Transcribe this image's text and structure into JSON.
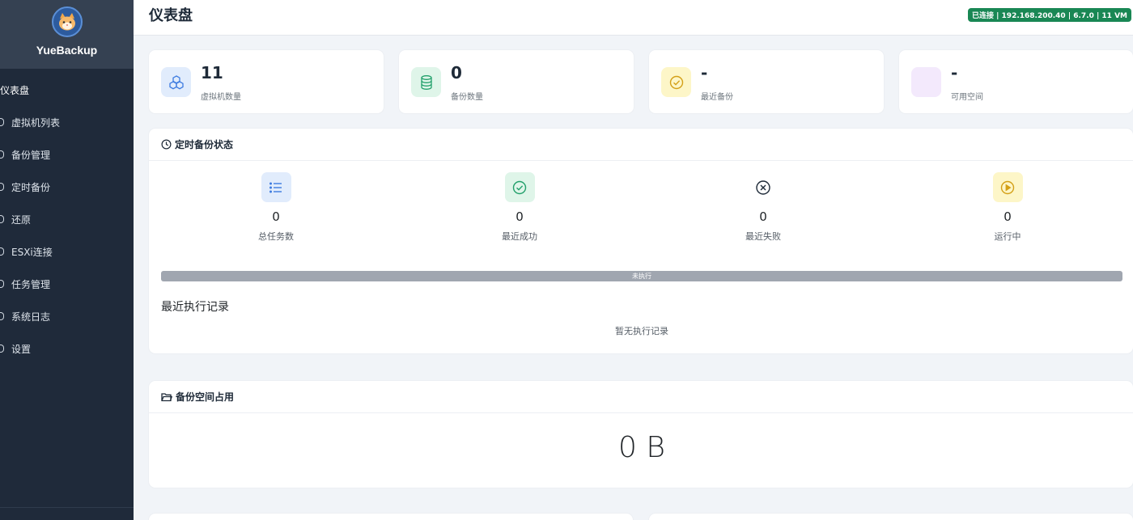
{
  "app": {
    "name": "YueBackup"
  },
  "sidebar": {
    "items": [
      {
        "label": "仪表盘"
      },
      {
        "label": "虚拟机列表"
      },
      {
        "label": "备份管理"
      },
      {
        "label": "定时备份"
      },
      {
        "label": "还原"
      },
      {
        "label": "ESXi连接"
      },
      {
        "label": "任务管理"
      },
      {
        "label": "系统日志"
      },
      {
        "label": "设置"
      }
    ]
  },
  "header": {
    "title": "仪表盘",
    "connection_badge": "已连接 | 192.168.200.40 | 6.7.0 | 11 VM"
  },
  "stats": [
    {
      "value": "11",
      "label": "虚拟机数量",
      "icon": "cubes-icon",
      "color": "#3d7be0"
    },
    {
      "value": "0",
      "label": "备份数量",
      "icon": "database-icon",
      "color": "#22a06b"
    },
    {
      "value": "-",
      "label": "最近备份",
      "icon": "check-circle-icon",
      "color": "#d4a017"
    },
    {
      "value": "-",
      "label": "可用空间",
      "icon": "disk-icon",
      "color": "#b88be0"
    }
  ],
  "schedule": {
    "title": "定时备份状态",
    "metrics": [
      {
        "value": "0",
        "label": "总任务数",
        "icon": "list-icon"
      },
      {
        "value": "0",
        "label": "最近成功",
        "icon": "check-circle-icon"
      },
      {
        "value": "0",
        "label": "最近失败",
        "icon": "x-circle-icon"
      },
      {
        "value": "0",
        "label": "运行中",
        "icon": "play-circle-icon"
      }
    ],
    "progress_label": "未执行",
    "progress_fraction": 1.0,
    "recent_title": "最近执行记录",
    "empty_text": "暂无执行记录"
  },
  "storage": {
    "title": "备份空间占用",
    "value": "0 B"
  }
}
